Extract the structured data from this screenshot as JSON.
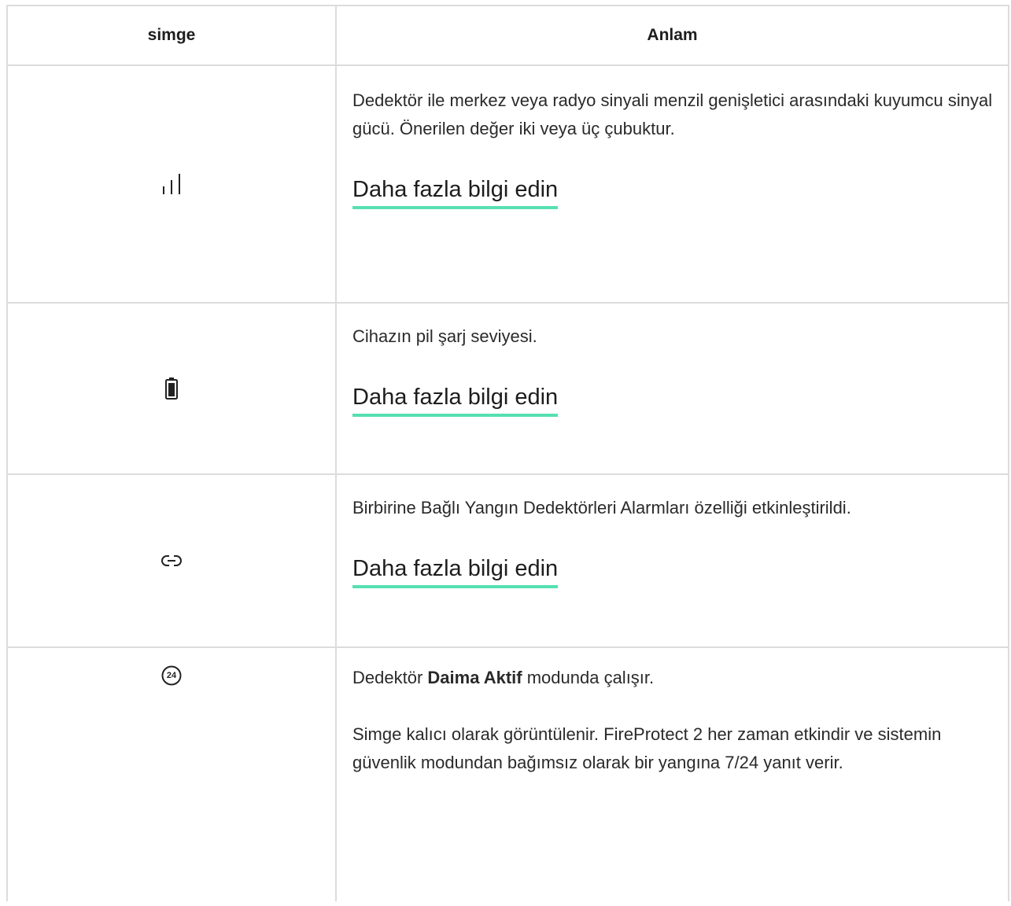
{
  "table": {
    "header": {
      "icon_col": "simge",
      "meaning_col": "Anlam"
    },
    "rows": [
      {
        "icon": "signal-strength-icon",
        "text": "Dedektör ile merkez veya radyo sinyali menzil genişletici arasındaki kuyumcu sinyal gücü. Önerilen değer iki veya üç çubuktur.",
        "link": "Daha fazla bilgi edin"
      },
      {
        "icon": "battery-icon",
        "text": "Cihazın pil şarj seviyesi.",
        "link": "Daha fazla bilgi edin"
      },
      {
        "icon": "link-icon",
        "text": "Birbirine Bağlı Yangın Dedektörleri Alarmları özelliği etkinleştirildi.",
        "link": "Daha fazla bilgi edin"
      },
      {
        "icon": "always-active-24-icon",
        "icon_label": "24",
        "text_before": "Dedektör ",
        "text_bold": "Daima Aktif",
        "text_after": " modunda çalışır.",
        "text2": "Simge kalıcı olarak görüntülenir. FireProtect 2 her zaman etkindir ve sistemin güvenlik modundan bağımsız olarak bir yangına 7/24 yanıt verir."
      }
    ]
  }
}
